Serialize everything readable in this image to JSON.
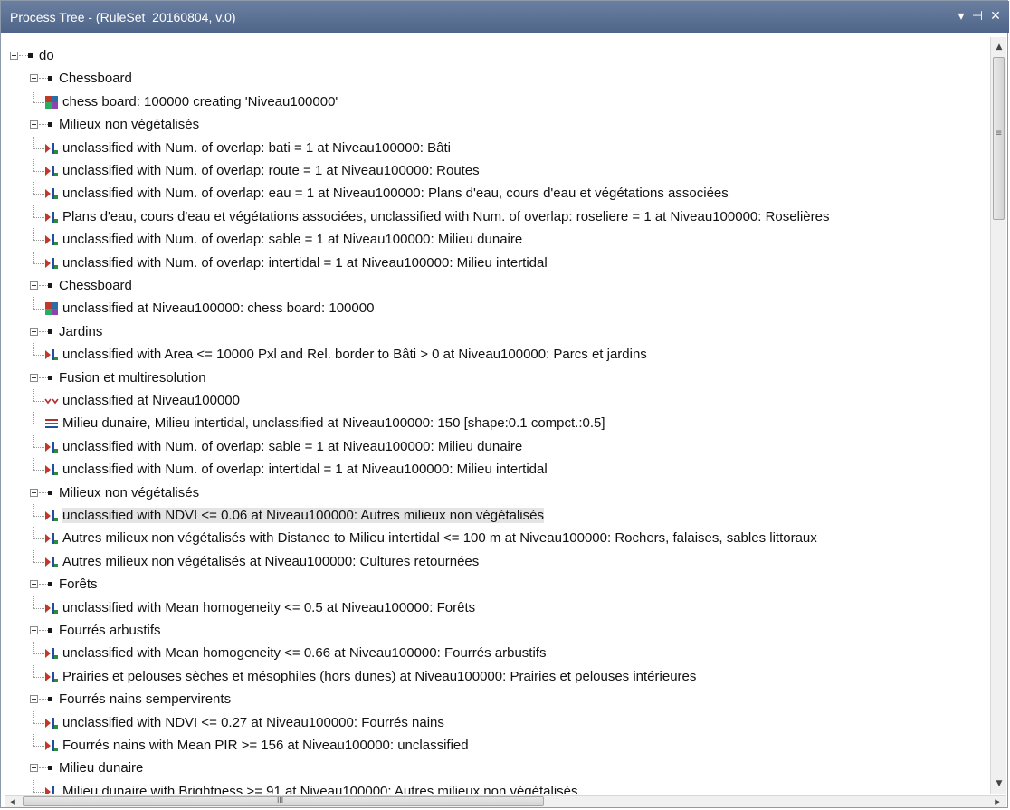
{
  "window": {
    "title": "Process Tree - (RuleSet_20160804, v.0)",
    "dropdown_glyph": "▾",
    "pin_glyph": "⊣",
    "close_glyph": "✕"
  },
  "scrollbar": {
    "up_glyph": "▲",
    "down_glyph": "▼",
    "left_glyph": "◂",
    "right_glyph": "▸",
    "grip_vertical": "≡",
    "grip_horizontal": "III"
  },
  "tree": [
    {
      "level": 0,
      "type": "root",
      "label": "do"
    },
    {
      "level": 1,
      "type": "group",
      "label": "Chessboard"
    },
    {
      "level": 2,
      "type": "chess",
      "label": "chess board: 100000 creating 'Niveau100000'"
    },
    {
      "level": 1,
      "type": "group",
      "label": "Milieux non végétalisés"
    },
    {
      "level": 2,
      "type": "assign",
      "label": "unclassified with Num. of overlap: bati = 1  at  Niveau100000: Bâti"
    },
    {
      "level": 2,
      "type": "assign",
      "label": "unclassified with Num. of overlap: route = 1  at  Niveau100000: Routes"
    },
    {
      "level": 2,
      "type": "assign",
      "label": "unclassified with Num. of overlap: eau = 1  at  Niveau100000: Plans d'eau, cours d'eau et végétations associées"
    },
    {
      "level": 2,
      "type": "assign",
      "label": "Plans d'eau, cours d'eau et végétations associées, unclassified with Num. of overlap: roseliere = 1  at  Niveau100000: Roselières"
    },
    {
      "level": 2,
      "type": "assign",
      "label": "unclassified with Num. of overlap: sable = 1  at  Niveau100000: Milieu dunaire"
    },
    {
      "level": 2,
      "type": "assign",
      "label": "unclassified with Num. of overlap: intertidal = 1  at  Niveau100000: Milieu intertidal"
    },
    {
      "level": 1,
      "type": "group",
      "label": "Chessboard"
    },
    {
      "level": 2,
      "type": "chess",
      "label": "unclassified at  Niveau100000: chess board: 100000"
    },
    {
      "level": 1,
      "type": "group",
      "label": "Jardins"
    },
    {
      "level": 2,
      "type": "assign",
      "label": "unclassified with Area <= 10000 Pxl and Rel. border to Bâti > 0  at  Niveau100000: Parcs et jardins"
    },
    {
      "level": 1,
      "type": "group",
      "label": "Fusion et multiresolution"
    },
    {
      "level": 2,
      "type": "merge",
      "label": "unclassified at  Niveau100000"
    },
    {
      "level": 2,
      "type": "multires",
      "label": "Milieu dunaire, Milieu intertidal, unclassified at  Niveau100000: 150 [shape:0.1 compct.:0.5]"
    },
    {
      "level": 2,
      "type": "assign",
      "label": "unclassified with Num. of overlap: sable = 1  at  Niveau100000: Milieu dunaire"
    },
    {
      "level": 2,
      "type": "assign",
      "label": "unclassified with Num. of overlap: intertidal = 1  at  Niveau100000: Milieu intertidal"
    },
    {
      "level": 1,
      "type": "group",
      "label": "Milieux non végétalisés"
    },
    {
      "level": 2,
      "type": "assign",
      "label": "unclassified with NDVI <= 0.06  at  Niveau100000: Autres milieux non végétalisés",
      "selected": true
    },
    {
      "level": 2,
      "type": "assign",
      "label": "Autres milieux non végétalisés with Distance to Milieu intertidal <= 100 m at  Niveau100000: Rochers, falaises, sables littoraux"
    },
    {
      "level": 2,
      "type": "assign",
      "label": "Autres milieux non végétalisés at  Niveau100000: Cultures retournées"
    },
    {
      "level": 1,
      "type": "group",
      "label": "Forêts"
    },
    {
      "level": 2,
      "type": "assign",
      "label": "unclassified with Mean homogeneity <= 0.5  at  Niveau100000: Forêts"
    },
    {
      "level": 1,
      "type": "group",
      "label": "Fourrés arbustifs"
    },
    {
      "level": 2,
      "type": "assign",
      "label": "unclassified with Mean homogeneity <= 0.66  at  Niveau100000: Fourrés arbustifs"
    },
    {
      "level": 2,
      "type": "assign",
      "label": "Prairies et pelouses sèches et mésophiles (hors dunes) at  Niveau100000: Prairies et pelouses intérieures"
    },
    {
      "level": 1,
      "type": "group",
      "label": "Fourrés nains sempervirents"
    },
    {
      "level": 2,
      "type": "assign",
      "label": "unclassified with NDVI <= 0.27  at  Niveau100000: Fourrés nains"
    },
    {
      "level": 2,
      "type": "assign",
      "label": "Fourrés nains with Mean PIR >= 156  at  Niveau100000: unclassified"
    },
    {
      "level": 1,
      "type": "group",
      "label": "Milieu dunaire"
    },
    {
      "level": 2,
      "type": "assign",
      "label": "Milieu dunaire with Brightness >= 91  at  Niveau100000: Autres milieux non végétalisés"
    }
  ]
}
